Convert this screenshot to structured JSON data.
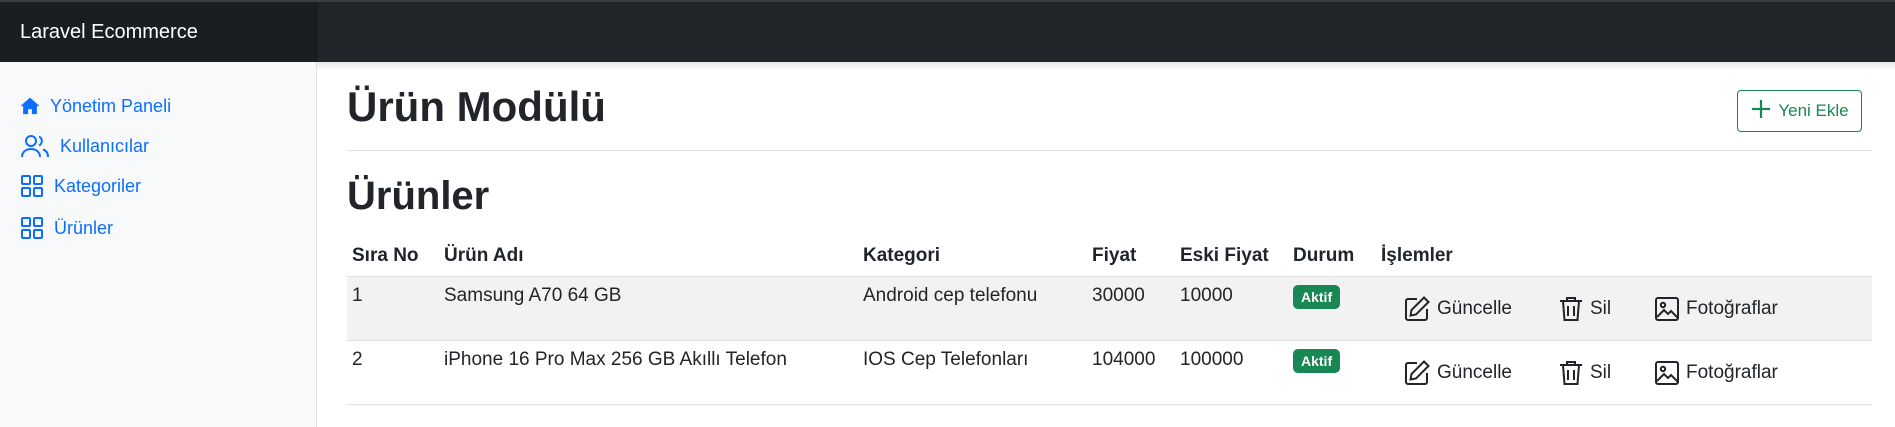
{
  "app": {
    "brand": "Laravel Ecommerce"
  },
  "sidebar": {
    "items": [
      {
        "label": "Yönetim Paneli",
        "icon": "house-icon"
      },
      {
        "label": "Kullanıcılar",
        "icon": "users-icon"
      },
      {
        "label": "Kategoriler",
        "icon": "grid-icon"
      },
      {
        "label": "Ürünler",
        "icon": "grid-icon"
      }
    ]
  },
  "main": {
    "page_title": "Ürün Modülü",
    "add_button": "Yeni Ekle",
    "section_title": "Ürünler"
  },
  "table": {
    "headers": [
      "Sıra No",
      "Ürün Adı",
      "Kategori",
      "Fiyat",
      "Eski Fiyat",
      "Durum",
      "İşlemler"
    ],
    "rows": [
      {
        "no": "1",
        "name": "Samsung A70 64 GB",
        "category": "Android cep telefonu",
        "price": "30000",
        "old_price": "10000",
        "status": "Aktif"
      },
      {
        "no": "2",
        "name": "iPhone 16 Pro Max 256 GB Akıllı Telefon",
        "category": "IOS Cep Telefonları",
        "price": "104000",
        "old_price": "100000",
        "status": "Aktif"
      }
    ],
    "actions": {
      "update": "Güncelle",
      "delete": "Sil",
      "photos": "Fotoğraflar"
    }
  },
  "colors": {
    "primary": "#0d6efd",
    "success": "#198754",
    "navbar": "#212529"
  }
}
